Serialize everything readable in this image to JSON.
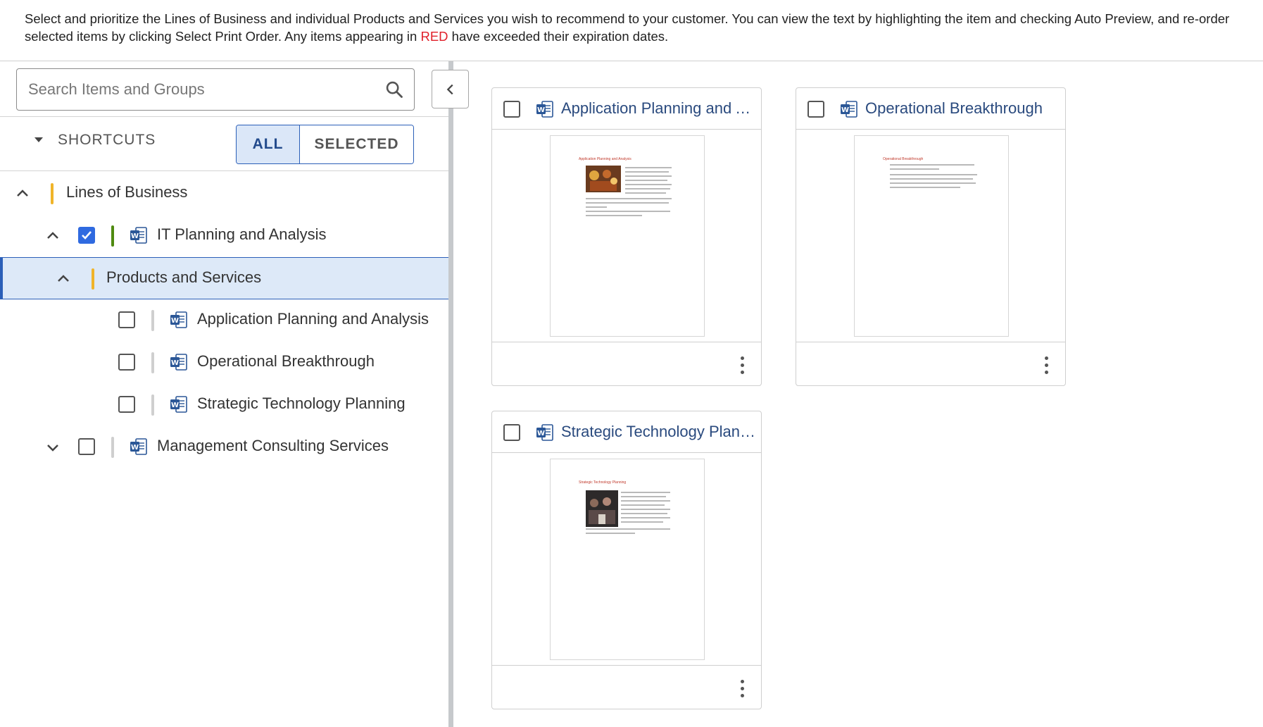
{
  "instructions": {
    "text_before": "Select and prioritize the Lines of Business and individual Products and Services you wish to recommend to your customer. You can view the text by highlighting the item and checking Auto Preview, and re-order selected items by clicking Select Print Order. Any items appearing in ",
    "red_word": "RED",
    "text_after": " have exceeded their expiration dates."
  },
  "search": {
    "placeholder": "Search Items and Groups"
  },
  "shortcuts": {
    "label": "SHORTCUTS",
    "all_label": "ALL",
    "selected_label": "SELECTED"
  },
  "tree": {
    "lines_of_business": "Lines of Business",
    "it_planning": "IT Planning and Analysis",
    "products_services": "Products and Services",
    "item_app_planning": "Application Planning and Analysis",
    "item_operational": "Operational Breakthrough",
    "item_strategic": "Strategic Technology Planning",
    "management_consulting": "Management Consulting Services"
  },
  "cards": [
    {
      "title": "Application Planning and Analysis",
      "doc_heading": "Application Planning and Analysis"
    },
    {
      "title": "Operational Breakthrough",
      "doc_heading": "Operational Breakthrough"
    },
    {
      "title": "Strategic Technology Planning",
      "doc_heading": "Strategic Technology Planning"
    }
  ],
  "colors": {
    "accent": "#2b5fb8",
    "selected_bg": "#dde9f8",
    "expired_red": "#e0202a",
    "yellow_bar": "#f0b429",
    "green_bar": "#4f8a10"
  },
  "icons": [
    "search-icon",
    "chevron-left-icon",
    "caret-down-icon",
    "chevron-up-icon",
    "chevron-down-icon",
    "word-doc-icon",
    "kebab-menu-icon"
  ]
}
